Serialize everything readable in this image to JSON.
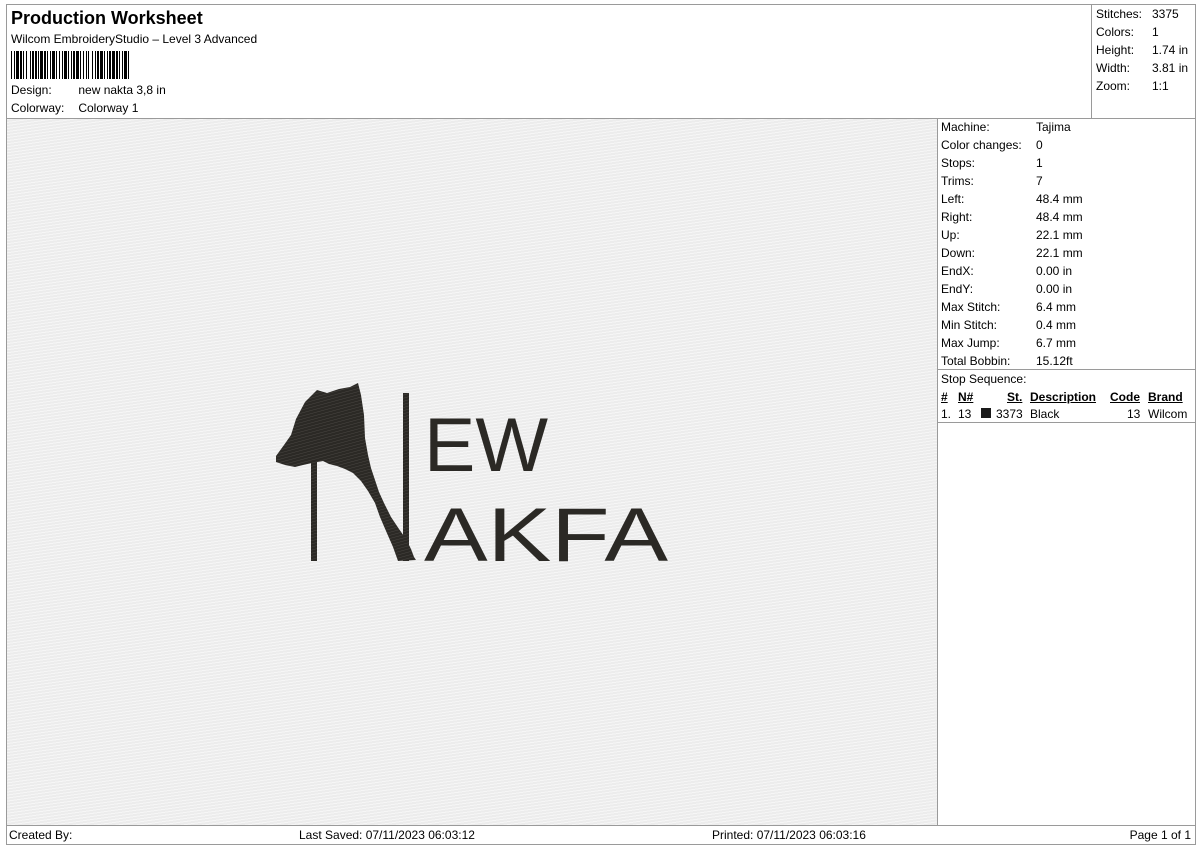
{
  "header": {
    "title": "Production Worksheet",
    "software": "Wilcom EmbroideryStudio – Level 3 Advanced",
    "design_label": "Design:",
    "design_value": "new nakta 3,8 in",
    "colorway_label": "Colorway:",
    "colorway_value": "Colorway 1"
  },
  "summary": [
    {
      "label": "Stitches:",
      "value": "3375"
    },
    {
      "label": "Colors:",
      "value": "1"
    },
    {
      "label": "Height:",
      "value": "1.74 in"
    },
    {
      "label": "Width:",
      "value": "3.81 in"
    },
    {
      "label": "Zoom:",
      "value": "1:1"
    }
  ],
  "machine": [
    {
      "label": "Machine:",
      "value": "Tajima"
    },
    {
      "label": "Color changes:",
      "value": "0"
    },
    {
      "label": "Stops:",
      "value": "1"
    },
    {
      "label": "Trims:",
      "value": "7"
    },
    {
      "label": "Left:",
      "value": "48.4 mm"
    },
    {
      "label": "Right:",
      "value": "48.4 mm"
    },
    {
      "label": "Up:",
      "value": "22.1 mm"
    },
    {
      "label": "Down:",
      "value": "22.1 mm"
    },
    {
      "label": "EndX:",
      "value": "0.00 in"
    },
    {
      "label": "EndY:",
      "value": "0.00 in"
    },
    {
      "label": "Max Stitch:",
      "value": "6.4 mm"
    },
    {
      "label": "Min Stitch:",
      "value": "0.4 mm"
    },
    {
      "label": "Max Jump:",
      "value": "6.7 mm"
    },
    {
      "label": "Total Bobbin:",
      "value": "15.12ft"
    }
  ],
  "stop_sequence": {
    "title": "Stop Sequence:",
    "headers": {
      "num": "#",
      "n": "N#",
      "st": "St.",
      "description": "Description",
      "code": "Code",
      "brand": "Brand"
    },
    "rows": [
      {
        "num": "1.",
        "n": "13",
        "color": "#1a1a1a",
        "st": "3373",
        "description": "Black",
        "code": "13",
        "brand": "Wilcom"
      }
    ]
  },
  "design_art": {
    "line1": "EW",
    "line2": "AKFA",
    "thread_color": "#2b2925"
  },
  "footer": {
    "created_by": "Created By:",
    "last_saved": "Last Saved: 07/11/2023 06:03:12",
    "printed": "Printed: 07/11/2023 06:03:16",
    "page": "Page 1 of 1"
  }
}
